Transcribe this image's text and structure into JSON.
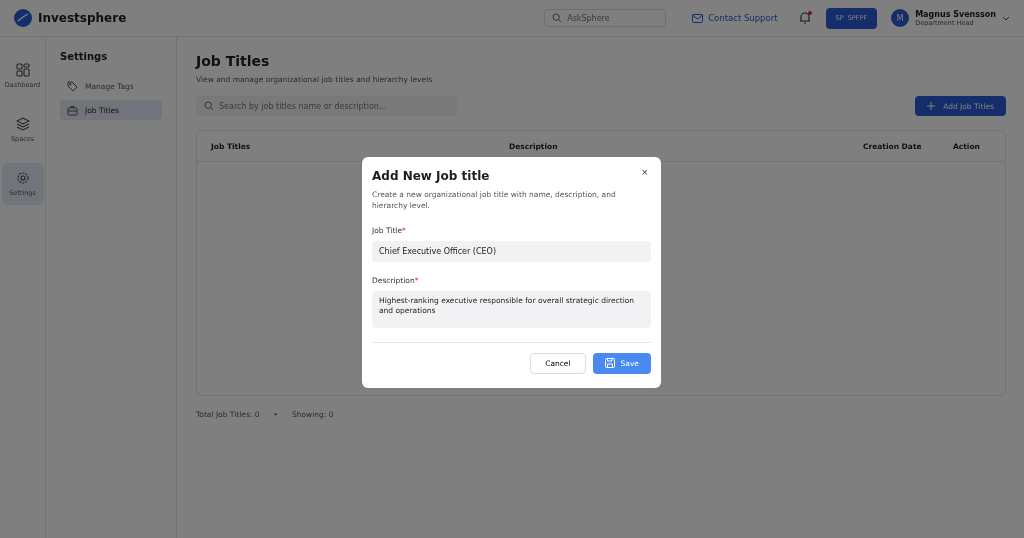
{
  "topbar": {
    "brand": "Investsphere",
    "search": {
      "placeholder": "AskSphere"
    },
    "support": "Contact Support",
    "notification_unread": true,
    "workspace_button": "SP  SPFPF",
    "user": {
      "initial": "M",
      "name": "Magnus Svensson",
      "role": "Department Head"
    }
  },
  "rail": [
    {
      "label": "Dashboard",
      "selected": false
    },
    {
      "label": "Spaces",
      "selected": false
    },
    {
      "label": "Settings",
      "selected": true
    }
  ],
  "settings_menu": {
    "title": "Settings",
    "items": [
      {
        "label": "Manage Tags",
        "selected": false
      },
      {
        "label": "Job Titles",
        "selected": true
      }
    ]
  },
  "page": {
    "title": "Job Titles",
    "subtitle": "View and manage organizational job titles and hierarchy levels",
    "search": {
      "placeholder": "Search by job titles name or description..."
    },
    "add_button": "Add Job Titles",
    "table": {
      "columns": [
        "Job Titles",
        "Description",
        "Creation Date",
        "Action"
      ]
    },
    "footer": {
      "total": "Total Job Titles: 0",
      "separator": "•",
      "showing": "Showing: 0"
    }
  },
  "modal": {
    "title": "Add New Job title",
    "description": "Create a new organizational job title with name, description, and hierarchy level.",
    "close": "×",
    "fields": [
      {
        "kind": "input",
        "label": "Job Title",
        "required_mark": "*",
        "value": "Chief Executive Officer (CEO)"
      },
      {
        "kind": "textarea",
        "label": "Description",
        "required_mark": "*",
        "value": "Highest-ranking executive responsible for overall strategic direction and operations"
      }
    ],
    "cancel": "Cancel",
    "save": "Save"
  }
}
